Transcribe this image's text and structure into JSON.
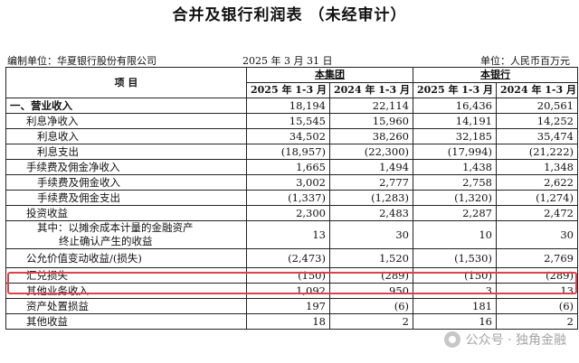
{
  "title": "合并及银行利润表 （未经审计）",
  "meta": {
    "unit_name": "编制单位：华夏银行股份有限公司",
    "date": "2025 年 3 月 31 日",
    "currency": "单位：人民币百万元"
  },
  "table": {
    "item_header": "项 目",
    "group_headers": [
      "本集团",
      "本银行"
    ],
    "period_headers": [
      "2025 年 1-3 月",
      "2024 年 1-3 月",
      "2025 年 1-3 月",
      "2024 年 1-3 月"
    ],
    "rows": [
      {
        "label": "一、营业收入",
        "values": [
          "18,194",
          "22,114",
          "16,436",
          "20,561"
        ]
      },
      {
        "label": "利息净收入",
        "values": [
          "15,545",
          "15,960",
          "14,191",
          "14,252"
        ]
      },
      {
        "label": "利息收入",
        "values": [
          "34,502",
          "38,260",
          "32,185",
          "35,474"
        ]
      },
      {
        "label": "利息支出",
        "values": [
          "(18,957)",
          "(22,300)",
          "(17,994)",
          "(21,222)"
        ]
      },
      {
        "label": "手续费及佣金净收入",
        "values": [
          "1,665",
          "1,494",
          "1,438",
          "1,348"
        ]
      },
      {
        "label": "手续费及佣金收入",
        "values": [
          "3,002",
          "2,777",
          "2,758",
          "2,622"
        ]
      },
      {
        "label": "手续费及佣金支出",
        "values": [
          "(1,337)",
          "(1,283)",
          "(1,320)",
          "(1,274)"
        ]
      },
      {
        "label": "投资收益",
        "values": [
          "2,300",
          "2,483",
          "2,287",
          "2,472"
        ]
      },
      {
        "label_line1": "其中：以摊余成本计量的金融资产",
        "label_line2": "终止确认产生的收益",
        "values": [
          "13",
          "30",
          "10",
          "30"
        ]
      },
      {
        "label": "公允价值变动收益/(损失)",
        "values": [
          "(2,473)",
          "1,520",
          "(1,530)",
          "2,769"
        ]
      },
      {
        "label": "汇兑损失",
        "values": [
          "(150)",
          "(289)",
          "(150)",
          "(289)"
        ]
      },
      {
        "label": "其他业务收入",
        "values": [
          "1,092",
          "950",
          "3",
          "13"
        ]
      },
      {
        "label": "资产处置损益",
        "values": [
          "197",
          "(6)",
          "181",
          "(6)"
        ]
      },
      {
        "label": "其他收益",
        "values": [
          "18",
          "2",
          "16",
          "2"
        ]
      }
    ]
  },
  "watermark": "公众号 · 独角金融",
  "highlight_color": "#e0404a"
}
